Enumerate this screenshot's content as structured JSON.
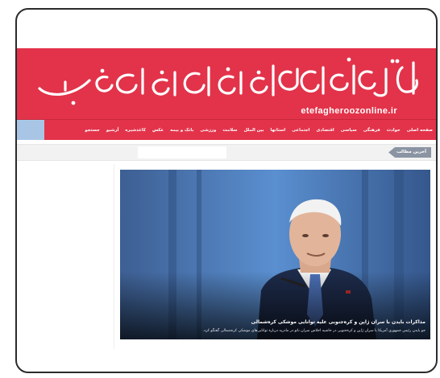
{
  "header": {
    "logo_text": "اتفاق روز آنلاین",
    "domain": "etefagheroozonline.ir"
  },
  "nav": {
    "items": [
      "صفحه اصلی",
      "حوادث",
      "فرهنگی",
      "سیاسی",
      "اقتصادی",
      "اجتماعی",
      "استانها",
      "بین الملل",
      "سلامت",
      "ورزشی",
      "بانک و بیمه",
      "عکس",
      "کاغذشیره",
      "آرشیو",
      "جستجو"
    ]
  },
  "ticker": {
    "label": "آخرین مطالب"
  },
  "feature": {
    "title": "مذاکرات بایدن با سران ژاپن و کره‌جنوبی علیه توانایی موشکی کره‌شمالی",
    "subtitle": "جو بایدن رئیس جمهوری آمریکا با سران ژاپن و کره‌جنوبی در حاشیه اجلاس سران ناتو در مادرید درباره توانایی‌های موشکی کره‌شمالی گفتگو کرد."
  },
  "colors": {
    "brand_red": "#e2334a",
    "ticker_label": "#8a94a3",
    "search_box": "#a9c5e6"
  }
}
